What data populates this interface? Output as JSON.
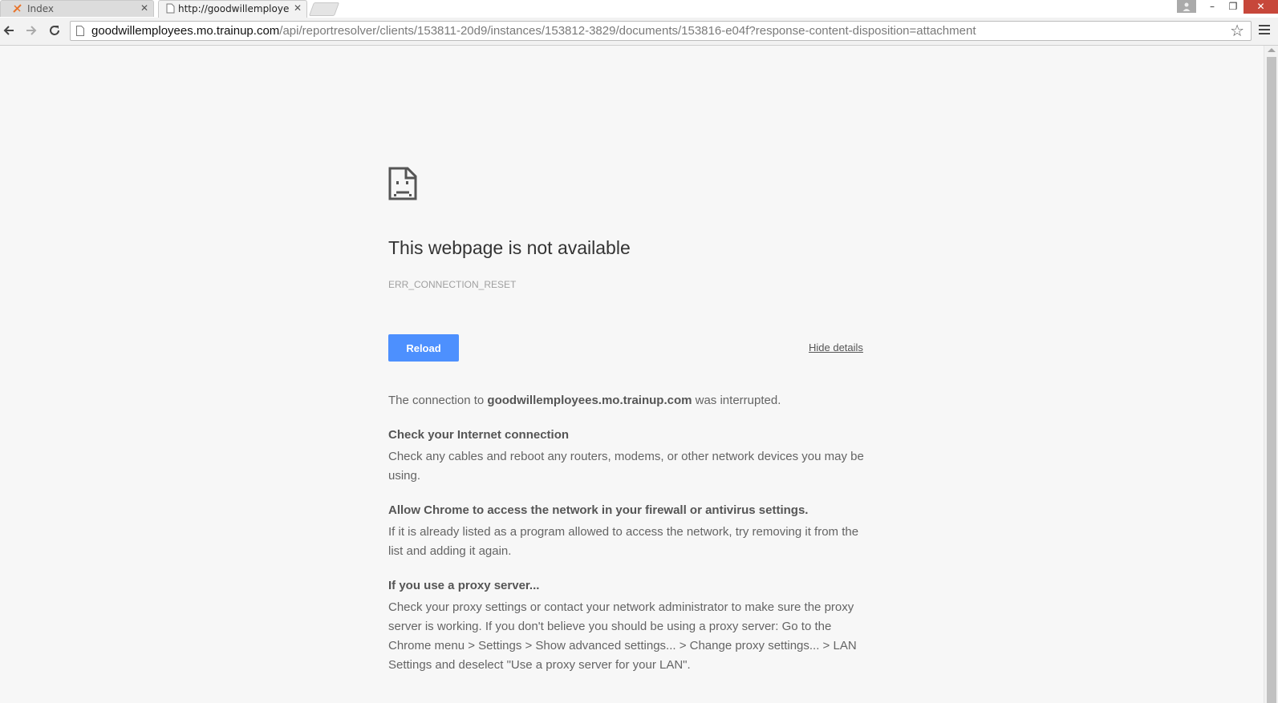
{
  "browser": {
    "tabs": [
      {
        "label": "Index",
        "active": false
      },
      {
        "label": "http://goodwillemployees",
        "active": true
      }
    ],
    "url_host": "goodwillemployees.mo.trainup.com",
    "url_path": "/api/reportresolver/clients/153811-20d9/instances/153812-3829/documents/153816-e04f?response-content-disposition=attachment",
    "window_buttons": {
      "minimize": "–",
      "maximize": "❐",
      "close": "✕"
    },
    "icons": [
      "back-arrow-icon",
      "forward-arrow-icon",
      "reload-icon",
      "page-icon",
      "star-icon",
      "menu-icon"
    ]
  },
  "error_page": {
    "title": "This webpage is not available",
    "code": "ERR_CONNECTION_RESET",
    "reload_label": "Reload",
    "details_link": "Hide details",
    "summary_prefix": "The connection to ",
    "summary_host": "goodwillemployees.mo.trainup.com",
    "summary_suffix": " was interrupted.",
    "sections": [
      {
        "heading": "Check your Internet connection",
        "body": "Check any cables and reboot any routers, modems, or other network devices you may be using."
      },
      {
        "heading": "Allow Chrome to access the network in your firewall or antivirus settings.",
        "body": "If it is already listed as a program allowed to access the network, try removing it from the list and adding it again."
      },
      {
        "heading": "If you use a proxy server...",
        "body": "Check your proxy settings or contact your network administrator to make sure the proxy server is working. If you don't believe you should be using a proxy server: Go to the Chrome menu > Settings > Show advanced settings... > Change proxy settings... > LAN Settings and deselect \"Use a proxy server for your LAN\"."
      }
    ]
  },
  "colors": {
    "reload_button": "#4d90fe",
    "close_button": "#c7473a"
  }
}
